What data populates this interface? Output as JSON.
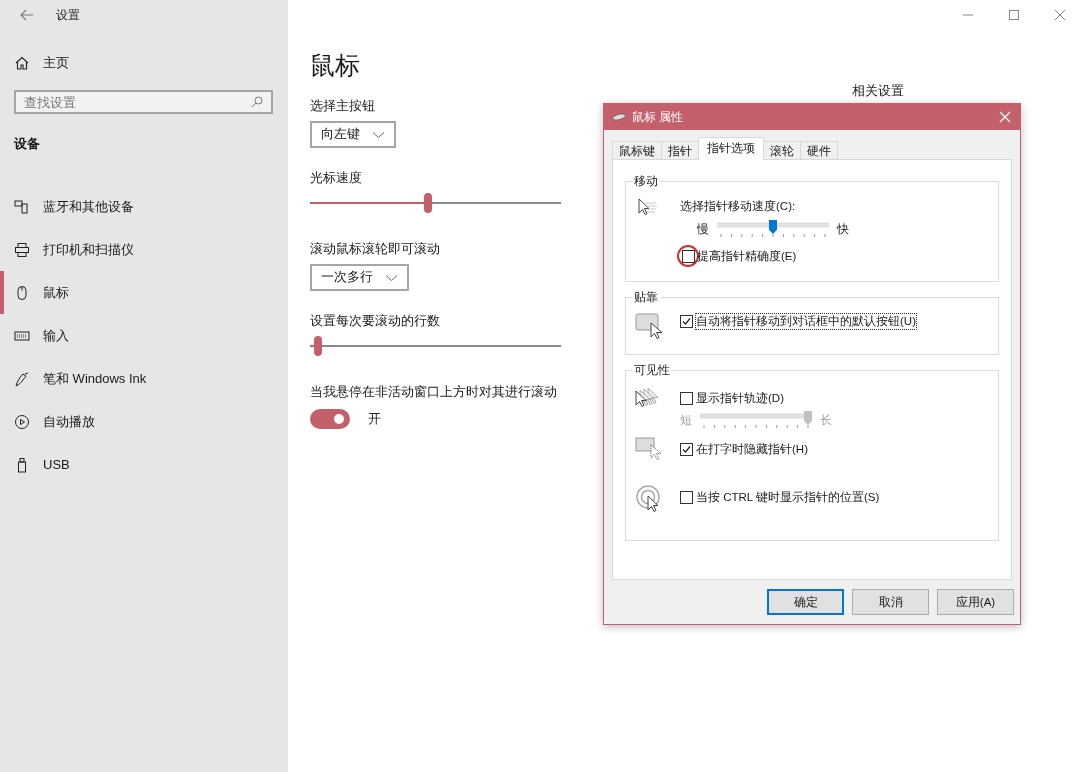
{
  "window": {
    "title": "设置"
  },
  "sidebar": {
    "home": "主页",
    "search": {
      "placeholder": "查找设置"
    },
    "section": "设备",
    "items": [
      {
        "label": "蓝牙和其他设备",
        "selected": false
      },
      {
        "label": "打印机和扫描仪",
        "selected": false
      },
      {
        "label": "鼠标",
        "selected": true
      },
      {
        "label": "输入",
        "selected": false
      },
      {
        "label": "笔和 Windows Ink",
        "selected": false
      },
      {
        "label": "自动播放",
        "selected": false
      },
      {
        "label": "USB",
        "selected": false
      }
    ]
  },
  "page": {
    "title": "鼠标",
    "related_heading": "相关设置",
    "settings": [
      {
        "kind": "dropdown",
        "label": "选择主按钮",
        "value": "向左键"
      },
      {
        "kind": "slider",
        "label": "光标速度",
        "level": 0.47
      },
      {
        "kind": "dropdown",
        "label": "滚动鼠标滚轮即可滚动",
        "value": "一次多行"
      },
      {
        "kind": "slider",
        "label": "设置每次要滚动的行数",
        "level": 0.03
      },
      {
        "kind": "toggle",
        "label": "当我悬停在非活动窗口上方时对其进行滚动",
        "on": true,
        "state_text": "开"
      }
    ]
  },
  "dialog": {
    "title": "鼠标 属性",
    "tabs": [
      {
        "label": "鼠标键",
        "selected": false
      },
      {
        "label": "指针",
        "selected": false
      },
      {
        "label": "指针选项",
        "selected": true
      },
      {
        "label": "滚轮",
        "selected": false
      },
      {
        "label": "硬件",
        "selected": false
      }
    ],
    "groups": [
      {
        "title": "移动",
        "blocks": [
          {
            "rows": [
              {
                "kind": "label",
                "label": "选择指针移动速度(C):"
              },
              {
                "kind": "slider",
                "min_label": "慢",
                "max_label": "快",
                "level": 0.5,
                "disabled": false
              },
              {
                "kind": "checkbox",
                "label": "提高指针精确度(E)",
                "checked": false,
                "highlighted": true
              }
            ]
          }
        ]
      },
      {
        "title": "贴靠",
        "blocks": [
          {
            "rows": [
              {
                "kind": "checkbox",
                "label": "自动将指针移动到对话框中的默认按钮(U)",
                "checked": true,
                "focused": true
              }
            ]
          }
        ]
      },
      {
        "title": "可见性",
        "blocks": [
          {
            "rows": [
              {
                "kind": "checkbox",
                "label": "显示指针轨迹(D)",
                "checked": false
              },
              {
                "kind": "slider",
                "min_label": "短",
                "max_label": "长",
                "level": 1,
                "disabled": true
              }
            ]
          },
          {
            "rows": [
              {
                "kind": "checkbox",
                "label": "在打字时隐藏指针(H)",
                "checked": true
              }
            ]
          },
          {
            "rows": [
              {
                "kind": "checkbox",
                "label": "当按 CTRL 键时显示指针的位置(S)",
                "checked": false
              }
            ]
          }
        ]
      }
    ],
    "buttons": [
      {
        "label": "确定",
        "default": true
      },
      {
        "label": "取消",
        "default": false
      },
      {
        "label": "应用(A)",
        "default": false
      }
    ]
  }
}
